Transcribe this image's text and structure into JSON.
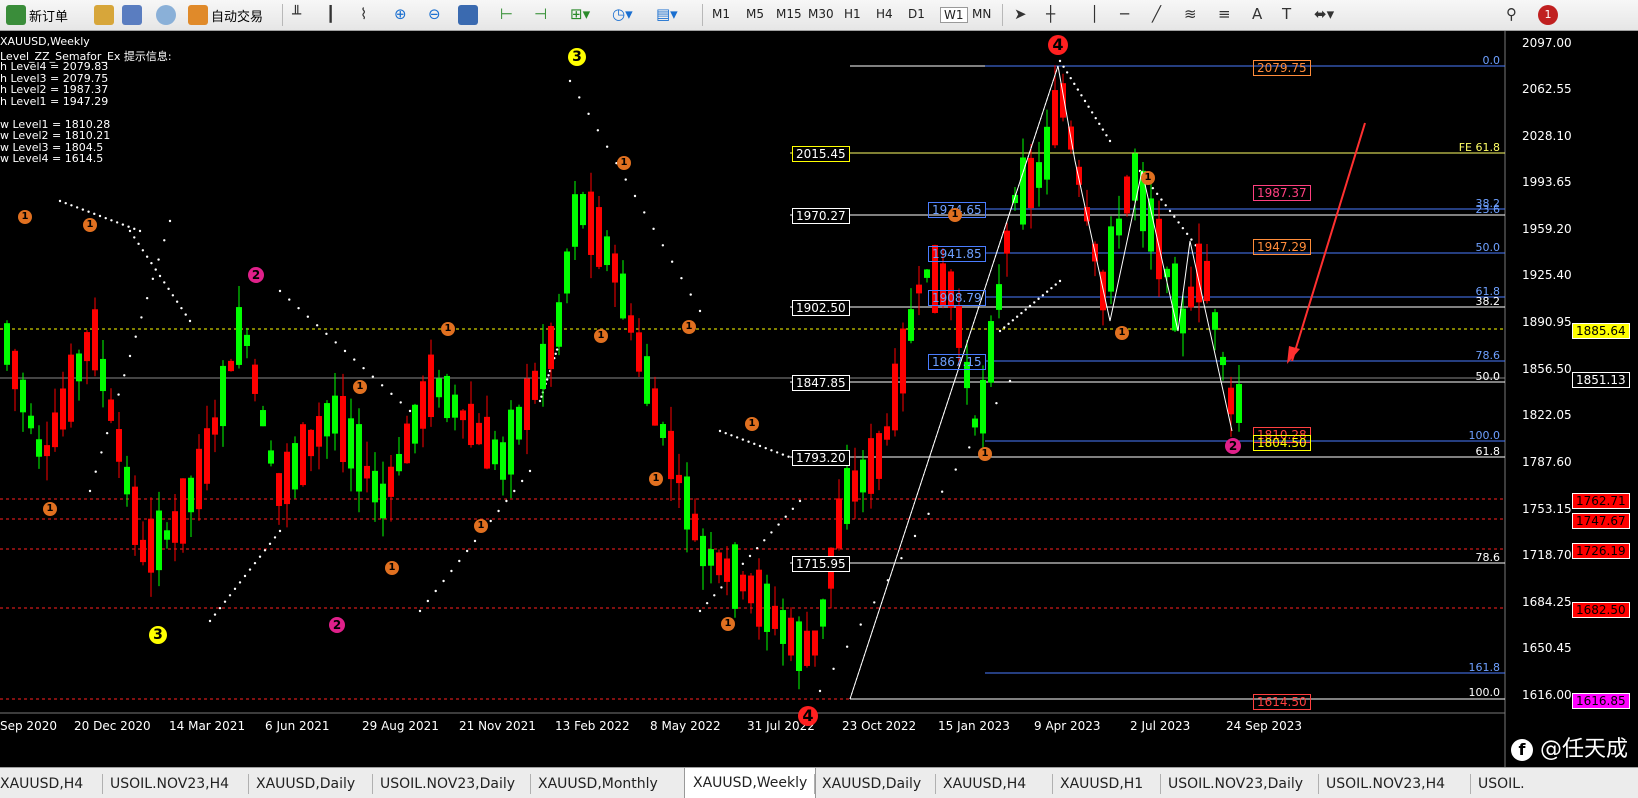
{
  "toolbar": {
    "new_order": "新订单",
    "auto_trade": "自动交易",
    "timeframes": [
      "M1",
      "M5",
      "M15",
      "M30",
      "H1",
      "H4",
      "D1",
      "W1",
      "MN"
    ],
    "alert_badge": "1"
  },
  "chart": {
    "symbol_title": "XAUUSD,Weekly",
    "indicator_title": "Level_ZZ_Semafor_Ex 提示信息:",
    "info_lines": [
      "h Level4 = 2079.83",
      "h Level3 = 2079.75",
      "h Level2 = 1987.37",
      "h Level1 = 1947.29",
      "",
      "w Level1 = 1810.28",
      "w Level2 = 1810.21",
      "w Level3 = 1804.5",
      "w Level4 = 1614.5"
    ],
    "price_axis": [
      "2097.00",
      "2062.55",
      "2028.10",
      "1993.65",
      "1959.20",
      "1925.40",
      "1890.95",
      "1856.50",
      "1822.05",
      "1787.60",
      "1753.15",
      "1718.70",
      "1684.25",
      "1650.45",
      "1616.00"
    ],
    "price_tags": [
      {
        "label": "1885.64",
        "bg": "#ffff00",
        "fg": "#000000"
      },
      {
        "label": "1851.13",
        "bg": "#000000",
        "fg": "#ffffff"
      },
      {
        "label": "1762.71",
        "bg": "#ff0000",
        "fg": "#000000"
      },
      {
        "label": "1747.67",
        "bg": "#ff0000",
        "fg": "#000000"
      },
      {
        "label": "1726.19",
        "bg": "#ff0000",
        "fg": "#000000"
      },
      {
        "label": "1682.50",
        "bg": "#ff0000",
        "fg": "#000000"
      },
      {
        "label": "1616.85",
        "bg": "#ff00ff",
        "fg": "#000000"
      }
    ],
    "date_axis": [
      "Sep 2020",
      "20 Dec 2020",
      "14 Mar 2021",
      "6 Jun 2021",
      "29 Aug 2021",
      "21 Nov 2021",
      "13 Feb 2022",
      "8 May 2022",
      "31 Jul 2022",
      "23 Oct 2022",
      "15 Jan 2023",
      "9 Apr 2023",
      "2 Jul 2023",
      "24 Sep 2023"
    ],
    "level_boxes": [
      "2015.45",
      "1970.27",
      "1902.50",
      "1847.85",
      "1793.20",
      "1715.95"
    ],
    "blue_boxes": [
      "1974.65",
      "1941.85",
      "1908.79",
      "1867.15"
    ],
    "semafor_boxes": [
      "2079.75",
      "1987.37",
      "1947.29",
      "1810.28",
      "1804.50",
      "1614.50"
    ],
    "fib_right": [
      "0.0",
      "FE 61.8",
      "38.2",
      "23.6",
      "50.0",
      "61.8",
      "38.2",
      "78.6",
      "50.0",
      "100.0",
      "61.8",
      "78.6",
      "161.8",
      "100.0"
    ],
    "semafor_numbers": [
      "1",
      "2",
      "3",
      "4"
    ],
    "colors": {
      "bull": "#00ff00",
      "bear": "#ff0000",
      "grid": "#444444"
    }
  },
  "watermark": "@任天成",
  "tabs": [
    "XAUUSD,H4",
    "USOIL.NOV23,H4",
    "XAUUSD,Daily",
    "USOIL.NOV23,Daily",
    "XAUUSD,Monthly",
    "XAUUSD,Weekly",
    "XAUUSD,Daily",
    "XAUUSD,H4",
    "XAUUSD,H1",
    "USOIL.NOV23,Daily",
    "USOIL.NOV23,H4",
    "USOIL."
  ],
  "active_tab_index": 5
}
